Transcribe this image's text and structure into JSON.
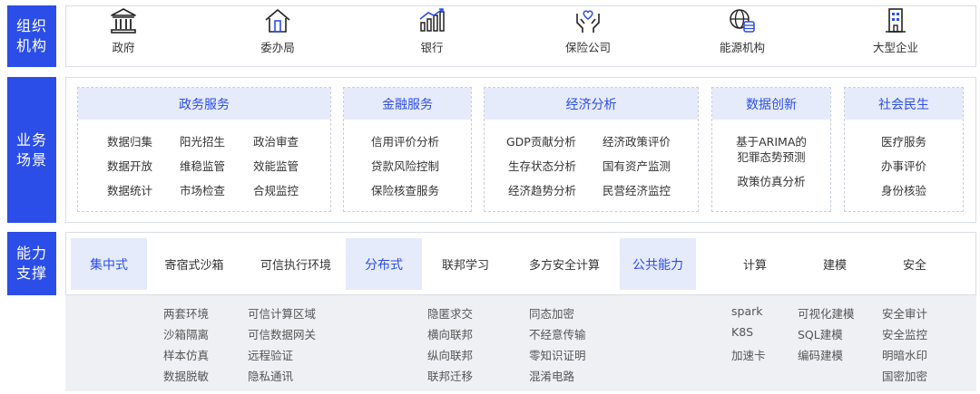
{
  "sidebar": {
    "row1": "组织机构",
    "row2": "业务场景",
    "row3": "能力支撑"
  },
  "organizations": [
    {
      "label": "政府",
      "icon": "government-building-icon"
    },
    {
      "label": "委办局",
      "icon": "house-icon"
    },
    {
      "label": "银行",
      "icon": "bar-chart-icon"
    },
    {
      "label": "保险公司",
      "icon": "hands-heart-icon"
    },
    {
      "label": "能源机构",
      "icon": "globe-database-icon"
    },
    {
      "label": "大型企业",
      "icon": "office-building-icon"
    }
  ],
  "scenarios": [
    {
      "title": "政务服务",
      "items": [
        "数据归集",
        "阳光招生",
        "政治审查",
        "数据开放",
        "维稳监管",
        "效能监管",
        "数据统计",
        "市场检查",
        "合规监控"
      ]
    },
    {
      "title": "金融服务",
      "items": [
        "信用评价分析",
        "贷款风险控制",
        "保险核查服务"
      ]
    },
    {
      "title": "经济分析",
      "items": [
        "GDP贡献分析",
        "经济政策评价",
        "生存状态分析",
        "国有资产监测",
        "经济趋势分析",
        "民营经济监控"
      ]
    },
    {
      "title": "数据创新",
      "items": [
        "基于ARIMA的",
        "犯罪态势预测",
        "政策仿真分析"
      ]
    },
    {
      "title": "社会民生",
      "items": [
        "医疗服务",
        "办事评价",
        "身份核验"
      ]
    }
  ],
  "capabilities": {
    "tabs": [
      "集中式",
      "寄宿式沙箱",
      "可信执行环境",
      "分布式",
      "联邦学习",
      "多方安全计算",
      "公共能力",
      "计算",
      "建模",
      "安全"
    ],
    "details": {
      "sandbox": [
        "两套环境",
        "沙箱隔离",
        "样本仿真",
        "数据脱敏"
      ],
      "tee": [
        "可信计算区域",
        "可信数据网关",
        "远程验证",
        "隐私通讯"
      ],
      "federated": [
        "隐匿求交",
        "横向联邦",
        "纵向联邦",
        "联邦迁移"
      ],
      "mpc": [
        "同态加密",
        "不经意传输",
        "零知识证明",
        "混淆电路"
      ],
      "compute": [
        "spark",
        "K8S",
        "加速卡"
      ],
      "modeling": [
        "可视化建模",
        "SQL建模",
        "编码建模"
      ],
      "security": [
        "安全审计",
        "安全监控",
        "明暗水印",
        "国密加密"
      ]
    }
  },
  "colors": {
    "accent": "#2b4ee8",
    "header_bg": "#e6ebfb",
    "panel_bg": "#eef0f3"
  }
}
